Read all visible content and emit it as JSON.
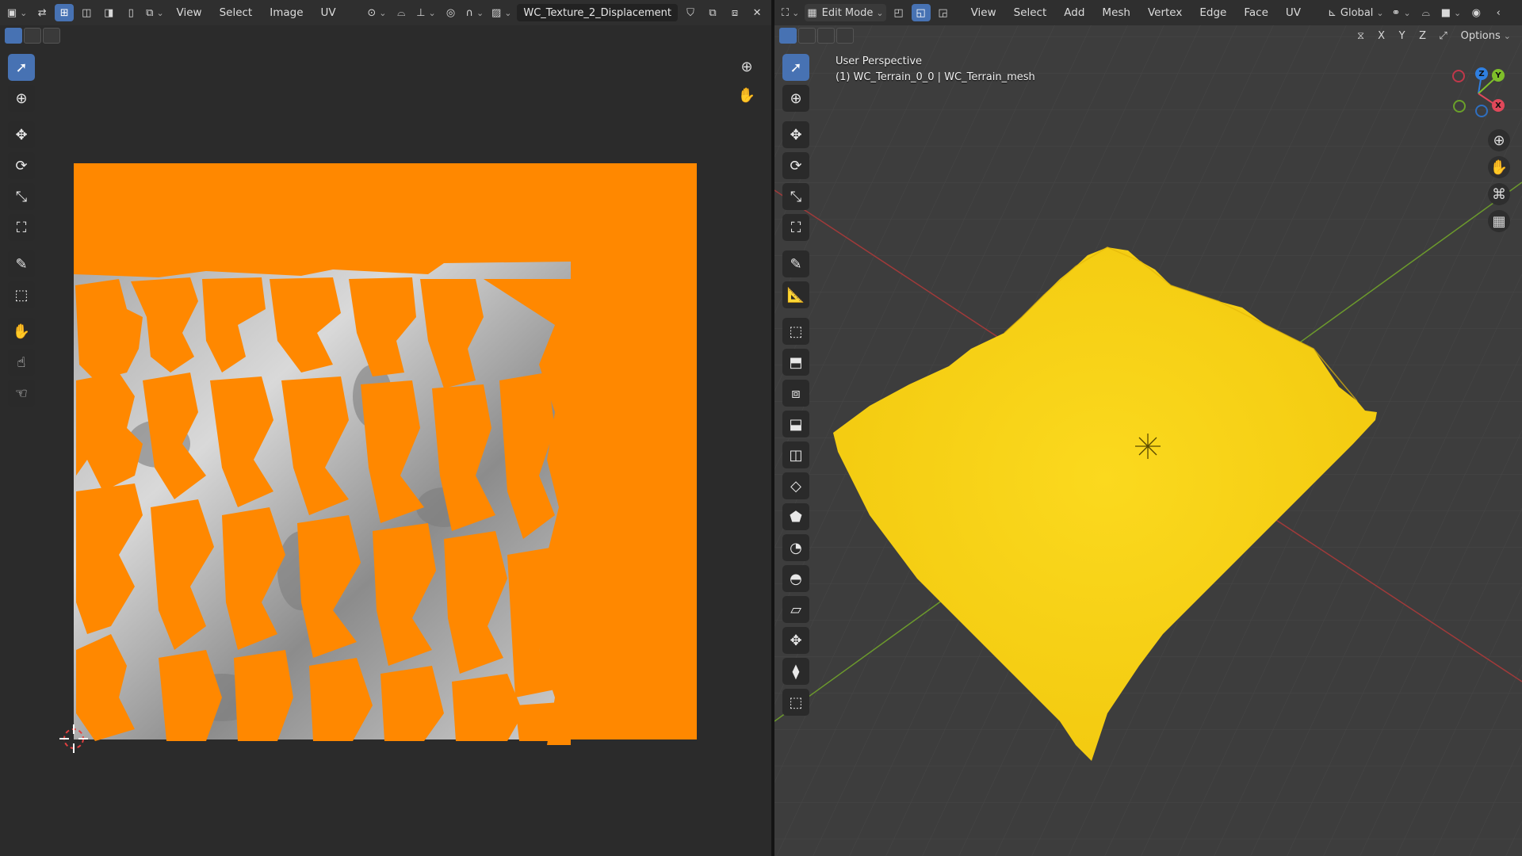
{
  "uv_editor": {
    "menus": [
      "View",
      "Select",
      "Image",
      "UV"
    ],
    "image_name": "WC_Texture_2_Displacement"
  },
  "viewport": {
    "mode": "Edit Mode",
    "menus": [
      "View",
      "Select",
      "Add",
      "Mesh",
      "Vertex",
      "Edge",
      "Face",
      "UV"
    ],
    "transform_orientation": "Global",
    "axis_x": "X",
    "axis_y": "Y",
    "axis_z": "Z",
    "options_label": "Options",
    "view_name": "User Perspective",
    "object_info": "(1) WC_Terrain_0_0 | WC_Terrain_mesh",
    "gizmo": {
      "x": "X",
      "y": "Y",
      "z": "Z"
    }
  },
  "colors": {
    "uv_selected": "#ff8800",
    "mesh_selected": "#f8d21c",
    "active_tool": "#4772b3"
  }
}
